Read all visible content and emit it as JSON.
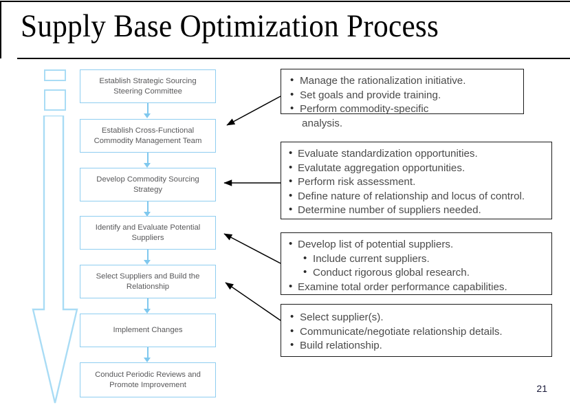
{
  "slide": {
    "title": "Supply Base Optimization Process",
    "page_number": "21",
    "colors": {
      "flow_box_border": "#8ecdf0",
      "flow_box_text": "#58585a",
      "connector": "#7fc8ee",
      "callout_border": "#1a1a1a",
      "callout_text": "#4a4a4a",
      "title_text": "#000000",
      "rule": "#000000"
    }
  },
  "flow": {
    "steps": [
      {
        "label": "Establish Strategic Sourcing Steering Committee"
      },
      {
        "label": "Establish Cross-Functional Commodity Management Team"
      },
      {
        "label": "Develop Commodity Sourcing Strategy"
      },
      {
        "label": "Identify and Evaluate Potential Suppliers"
      },
      {
        "label": "Select Suppliers and Build the Relationship"
      },
      {
        "label": "Implement Changes"
      },
      {
        "label": "Conduct Periodic Reviews and Promote Improvement"
      }
    ]
  },
  "callouts": [
    {
      "id": "callout-1",
      "items": [
        {
          "text": "Manage the rationalization initiative.",
          "level": 1,
          "bullet": true
        },
        {
          "text": "Set goals and provide training.",
          "level": 1,
          "bullet": true
        },
        {
          "text": "Perform commodity-specific",
          "level": 1,
          "bullet": true,
          "spaced": true
        },
        {
          "text": "analysis.",
          "level": 1,
          "bullet": false,
          "continuation": true
        }
      ]
    },
    {
      "id": "callout-2",
      "items": [
        {
          "text": "Evaluate standardization opportunities.",
          "level": 1,
          "bullet": true
        },
        {
          "text": "Evalutate aggregation opportunities.",
          "level": 1,
          "bullet": true
        },
        {
          "text": "Perform risk assessment.",
          "level": 1,
          "bullet": true
        },
        {
          "text": "Define nature of relationship and locus of control.",
          "level": 1,
          "bullet": true
        },
        {
          "text": "Determine number of suppliers needed.",
          "level": 1,
          "bullet": true
        }
      ]
    },
    {
      "id": "callout-3",
      "items": [
        {
          "text": "Develop list of potential suppliers.",
          "level": 1,
          "bullet": true
        },
        {
          "text": "Include current suppliers.",
          "level": 2,
          "bullet": true
        },
        {
          "text": "Conduct rigorous global research.",
          "level": 2,
          "bullet": true
        },
        {
          "text": "Examine total order performance capabilities.",
          "level": 1,
          "bullet": true
        }
      ]
    },
    {
      "id": "callout-4",
      "items": [
        {
          "text": "Select supplier(s).",
          "level": 1,
          "bullet": true,
          "spaced": true
        },
        {
          "text": "Communicate/negotiate relationship details.",
          "level": 1,
          "bullet": true,
          "spaced": true
        },
        {
          "text": "Build relationship.",
          "level": 1,
          "bullet": true,
          "spaced": true
        }
      ]
    }
  ],
  "decoration": {
    "mini_rect_1": "small-rectangle-top",
    "mini_rect_2": "small-rectangle-second",
    "big_arrow": "large-downward-process-arrow"
  }
}
